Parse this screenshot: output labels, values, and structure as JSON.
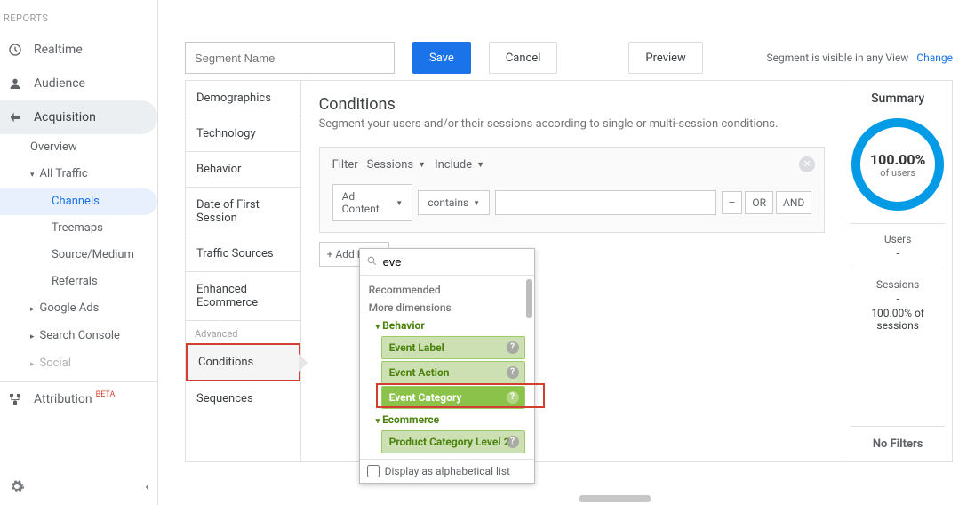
{
  "leftnav": {
    "header": "REPORTS",
    "items": [
      {
        "label": "Realtime"
      },
      {
        "label": "Audience"
      },
      {
        "label": "Acquisition"
      }
    ],
    "acq": {
      "overview": "Overview",
      "alltraffic": "All Traffic",
      "channels": "Channels",
      "treemaps": "Treemaps",
      "sourcemedium": "Source/Medium",
      "referrals": "Referrals",
      "googleads": "Google Ads",
      "searchconsole": "Search Console",
      "social": "Social"
    },
    "attribution": "Attribution",
    "beta": "BETA"
  },
  "top": {
    "segname_placeholder": "Segment Name",
    "save": "Save",
    "cancel": "Cancel",
    "preview": "Preview",
    "vis_text": "Segment is visible in any View",
    "vis_link": "Change"
  },
  "cats": {
    "demographics": "Demographics",
    "technology": "Technology",
    "behavior": "Behavior",
    "firstsession": "Date of First Session",
    "trafficsources": "Traffic Sources",
    "enhecom": "Enhanced Ecommerce",
    "advanced": "Advanced",
    "conditions": "Conditions",
    "sequences": "Sequences"
  },
  "editor": {
    "title": "Conditions",
    "desc": "Segment your users and/or their sessions according to single or multi-session conditions.",
    "filter_label": "Filter",
    "sessions_label": "Sessions",
    "include_label": "Include",
    "adcontent": "Ad Content",
    "contains": "contains",
    "minus": "–",
    "or": "OR",
    "and": "AND",
    "addfilter": "+ Add Filter"
  },
  "pop": {
    "search_value": "eve",
    "recommended": "Recommended",
    "moredims": "More dimensions",
    "group_behavior": "Behavior",
    "evlabel": "Event Label",
    "evaction": "Event Action",
    "evcat": "Event Category",
    "group_ecom": "Ecommerce",
    "prodcat2": "Product Category Level 2",
    "alpha": "Display as alphabetical list"
  },
  "summary": {
    "title": "Summary",
    "pct": "100.00%",
    "ofusers": "of users",
    "users_l": "Users",
    "users_v": "-",
    "sessions_l": "Sessions",
    "sessions_v": "-",
    "sessions_pct": "100.00% of sessions",
    "nofilters": "No Filters"
  }
}
